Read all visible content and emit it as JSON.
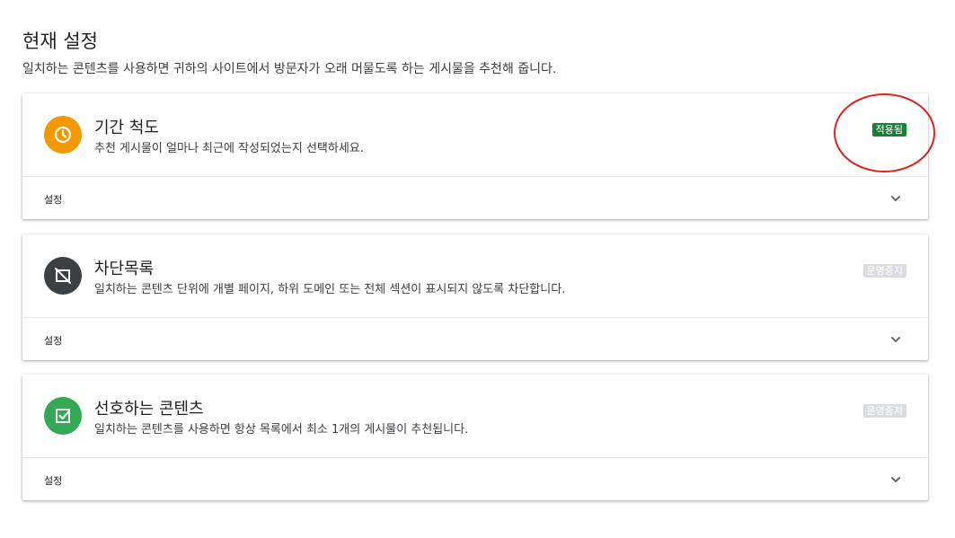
{
  "header": {
    "title": "현재 설정",
    "description": "일치하는 콘텐츠를 사용하면 귀하의 사이트에서 방문자가 오래 머물도록 하는 게시물을 추천해 줍니다."
  },
  "cards": [
    {
      "title": "기간 척도",
      "subtitle": "추천 게시물이 얼마나 최근에 작성되었는지 선택하세요.",
      "status": "적용됨",
      "icon": "clock-icon",
      "icon_color": "#f29900",
      "settings_label": "설정"
    },
    {
      "title": "차단목록",
      "subtitle": "일치하는 콘텐츠 단위에 개별 페이지, 하위 도메인 또는 전체 섹션이 표시되지 않도록 차단합니다.",
      "status": "운영중지",
      "icon": "blocked-icon",
      "icon_color": "#3c4043",
      "settings_label": "설정"
    },
    {
      "title": "선호하는 콘텐츠",
      "subtitle": "일치하는 콘텐츠를 사용하면 항상 목록에서 최소 1개의 게시물이 추천됩니다.",
      "status": "운영중지",
      "icon": "checkbox-icon",
      "icon_color": "#34a853",
      "settings_label": "설정"
    }
  ],
  "colors": {
    "active_badge": "#188038",
    "inactive_badge": "#dadce0",
    "highlight": "#e0201b"
  }
}
